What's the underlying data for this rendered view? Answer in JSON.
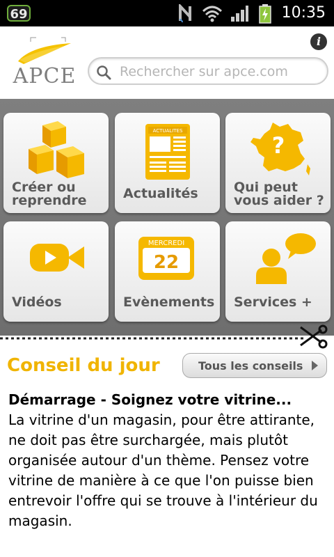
{
  "status_bar": {
    "notification_count": "69",
    "time": "10:35"
  },
  "header": {
    "logo_text": "APCE",
    "search_placeholder": "Rechercher sur apce.com"
  },
  "tiles": [
    {
      "label_line1": "Créer ou",
      "label_line2": "reprendre",
      "icon": "cubes-icon"
    },
    {
      "label_line1": "Actualités",
      "label_line2": "",
      "icon": "newspaper-icon",
      "icon_caption": "ACTUALITES"
    },
    {
      "label_line1": "Qui peut",
      "label_line2": "vous aider ?",
      "icon": "france-map-icon"
    },
    {
      "label_line1": "Vidéos",
      "label_line2": "",
      "icon": "video-camera-icon"
    },
    {
      "label_line1": "Evènements",
      "label_line2": "",
      "icon": "calendar-icon",
      "calendar_day_name": "MERCREDI",
      "calendar_day_number": "22"
    },
    {
      "label_line1": "Services +",
      "label_line2": "",
      "icon": "person-chat-icon"
    }
  ],
  "conseil": {
    "title": "Conseil du jour",
    "all_tips_label": "Tous les conseils",
    "tip_heading": "Démarrage - Soignez votre vitrine...",
    "tip_text": "La vitrine d'un magasin, pour être attirante, ne doit pas être surchargée, mais plutôt organisée autour d'un thème. Pensez votre vitrine de manière à ce que l'on puisse bien entrevoir l'offre qui se trouve à l'intérieur du magasin."
  },
  "colors": {
    "accent_yellow": "#f5b800",
    "grid_background": "#777777",
    "label_gray": "#5a5a5a"
  }
}
